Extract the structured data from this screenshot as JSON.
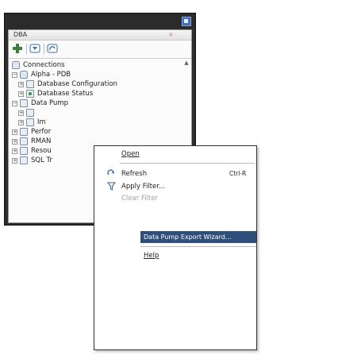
{
  "window": {
    "tab_label": "DBA",
    "tab_close": "×"
  },
  "toolbar": {
    "buttons": [
      "add-connection-icon",
      "filter-icon",
      "refresh-icon"
    ]
  },
  "tree": {
    "items": [
      {
        "label": "Connections"
      },
      {
        "label": "Alpha - PDB"
      },
      {
        "label": "Database Configuration"
      },
      {
        "label": "Database Status"
      },
      {
        "label": "Data Pump"
      },
      {
        "label": ""
      },
      {
        "label": "Im"
      },
      {
        "label": "Perfor"
      },
      {
        "label": "RMAN"
      },
      {
        "label": "Resou"
      },
      {
        "label": "SQL Tr"
      }
    ]
  },
  "context_menu": {
    "open": "Open",
    "refresh": "Refresh",
    "refresh_shortcut": "Ctrl-R",
    "apply_filter": "Apply Filter...",
    "clear_filter": "Clear Filter",
    "highlighted": "Data Pump Export Wizard...",
    "help": "Help"
  }
}
